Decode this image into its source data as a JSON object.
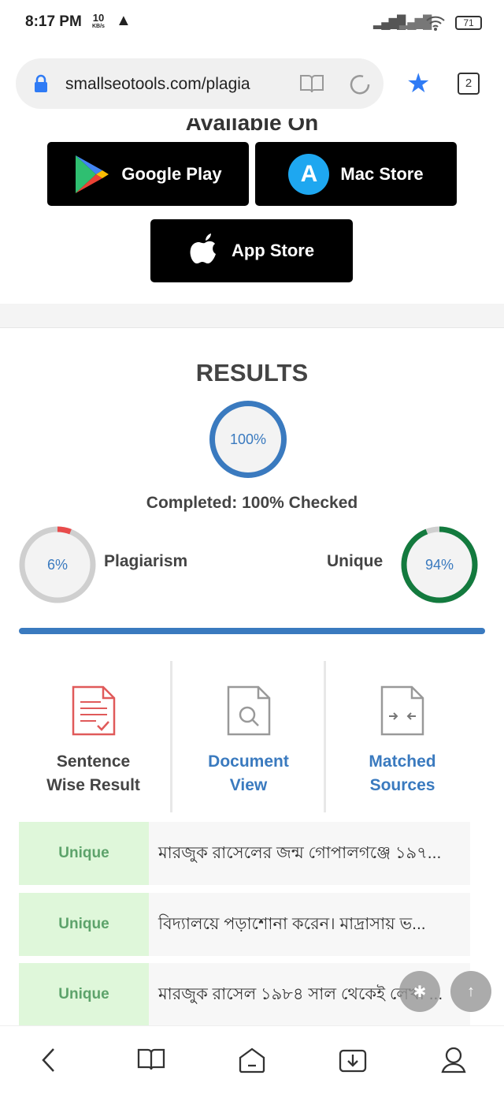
{
  "status_bar": {
    "time": "8:17 PM",
    "speed_value": "10",
    "speed_unit": "KB/s",
    "battery": "71"
  },
  "browser": {
    "url": "smallseotools.com/plagia",
    "tab_count": "2",
    "accent": "#2f7bf5"
  },
  "available": {
    "heading": "Available On",
    "google_play": "Google Play",
    "mac_store": "Mac Store",
    "app_store": "App Store"
  },
  "results": {
    "title": "RESULTS",
    "progress": "100%",
    "completed": "Completed: 100% Checked",
    "plagiarism_pct": "6%",
    "plagiarism_label": "Plagiarism",
    "plagiarism_value": 6,
    "unique_pct": "94%",
    "unique_label": "Unique",
    "unique_value": 94,
    "colors": {
      "blue": "#3a7abf",
      "red": "#e84b4b",
      "green": "#137a3e"
    }
  },
  "tabs": [
    {
      "line1": "Sentence",
      "line2": "Wise Result"
    },
    {
      "line1": "Document",
      "line2": "View"
    },
    {
      "line1": "Matched",
      "line2": "Sources"
    }
  ],
  "rows": [
    {
      "status": "Unique",
      "text": "মারজুক রাসেলের জন্ম গোপালগঞ্জে ১৯৭..."
    },
    {
      "status": "Unique",
      "text": "বিদ্যালয়ে পড়াশোনা করেন। মাদ্রাসায় ভ..."
    },
    {
      "status": "Unique",
      "text": "মারজুক রাসেল ১৯৮৪ সাল থেকেই লেখা ..."
    }
  ],
  "fab": {
    "up_arrow": "↑"
  }
}
